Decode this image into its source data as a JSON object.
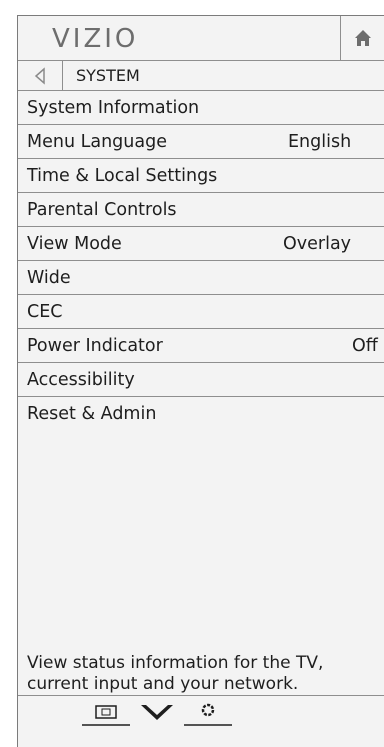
{
  "header": {
    "logo_text": "VIZIO",
    "home_icon": "home-icon"
  },
  "nav": {
    "back_icon": "back-arrow-icon",
    "title": "SYSTEM"
  },
  "menu": {
    "items": [
      {
        "label": "System Information",
        "value": ""
      },
      {
        "label": "Menu Language",
        "value": "English"
      },
      {
        "label": "Time & Local Settings",
        "value": ""
      },
      {
        "label": "Parental Controls",
        "value": ""
      },
      {
        "label": "View Mode",
        "value": "Overlay"
      },
      {
        "label": "Wide",
        "value": ""
      },
      {
        "label": "CEC",
        "value": ""
      },
      {
        "label": "Power Indicator",
        "value": "Off"
      },
      {
        "label": "Accessibility",
        "value": ""
      },
      {
        "label": "Reset & Admin",
        "value": ""
      }
    ]
  },
  "help": {
    "text": "View status information for the TV, current input and your network."
  },
  "bottom_bar": {
    "icons": [
      "input-icon",
      "chevron-down-icon",
      "settings-icon"
    ]
  },
  "colors": {
    "panel_bg": "#f3f3f3",
    "divider": "#8e8e8e",
    "text": "#1e1e1e",
    "logo": "#6d6d6d"
  }
}
